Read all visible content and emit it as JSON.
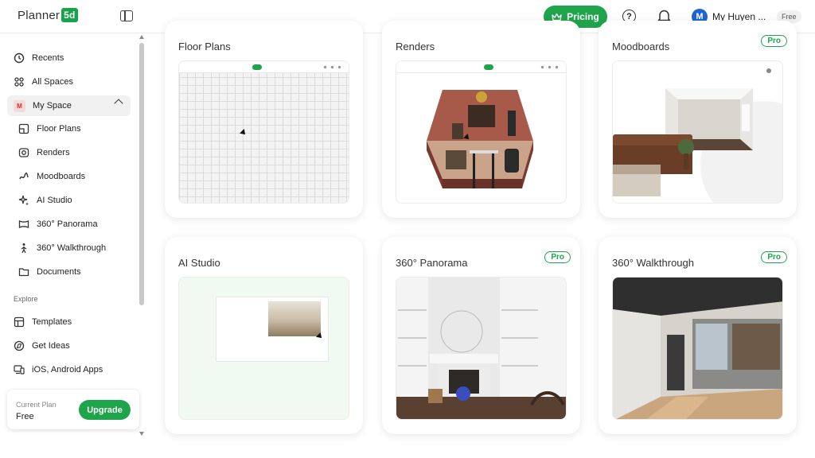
{
  "header": {
    "logo_text": "Planner",
    "logo_badge": "5d",
    "pricing_label": "Pricing",
    "help_glyph": "?",
    "user_initial": "M",
    "user_name": "My Huyen ...",
    "plan_badge": "Free"
  },
  "sidebar": {
    "items": [
      {
        "label": "Recents",
        "icon": "clock-icon"
      },
      {
        "label": "All Spaces",
        "icon": "grid-icon"
      },
      {
        "label": "My Space",
        "icon": "m-badge",
        "initial": "M"
      },
      {
        "label": "Floor Plans",
        "icon": "floorplan-icon"
      },
      {
        "label": "Renders",
        "icon": "camera-icon"
      },
      {
        "label": "Moodboards",
        "icon": "brush-icon"
      },
      {
        "label": "AI Studio",
        "icon": "sparkle-icon"
      },
      {
        "label": "360° Panorama",
        "icon": "panorama-icon"
      },
      {
        "label": "360° Walkthrough",
        "icon": "walk-icon"
      },
      {
        "label": "Documents",
        "icon": "folder-icon"
      }
    ],
    "explore_label": "Explore",
    "explore_items": [
      {
        "label": "Templates",
        "icon": "template-icon"
      },
      {
        "label": "Get Ideas",
        "icon": "globe-icon"
      },
      {
        "label": "iOS, Android Apps",
        "icon": "devices-icon"
      }
    ],
    "plan_card": {
      "label": "Current Plan",
      "value": "Free",
      "upgrade_label": "Upgrade"
    }
  },
  "cards": [
    {
      "title": "Floor Plans",
      "pro": ""
    },
    {
      "title": "Renders",
      "pro": ""
    },
    {
      "title": "Moodboards",
      "pro": "Pro"
    },
    {
      "title": "AI Studio",
      "pro": ""
    },
    {
      "title": "360° Panorama",
      "pro": "Pro"
    },
    {
      "title": "360° Walkthrough",
      "pro": "Pro"
    }
  ],
  "colors": {
    "accent": "#1ea44b",
    "avatar": "#1f64d6"
  }
}
